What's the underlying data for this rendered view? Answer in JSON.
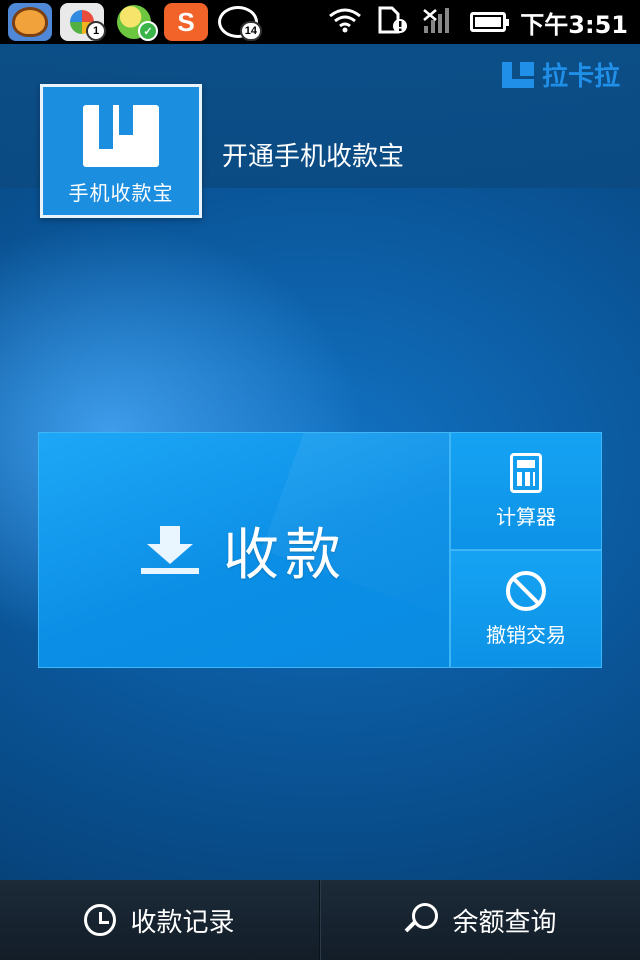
{
  "status_bar": {
    "notifications": [
      {
        "name": "monkey-app-icon"
      },
      {
        "name": "photo-app-icon",
        "badge": "1"
      },
      {
        "name": "qq-app-icon",
        "badge": "✓"
      },
      {
        "name": "sogou-app-icon"
      },
      {
        "name": "chat-app-icon",
        "badge": "14"
      }
    ],
    "icons": [
      "wifi-icon",
      "sim-alert-icon",
      "signal-icon",
      "battery-icon"
    ],
    "time": "下午3:51"
  },
  "header": {
    "brand": "拉卡拉",
    "app_tile_label": "手机收款宝",
    "open_text": "开通手机收款宝"
  },
  "actions": {
    "collect_label": "收款",
    "calculator_label": "计算器",
    "cancel_label": "撤销交易"
  },
  "bottom_nav": {
    "records_label": "收款记录",
    "balance_label": "余额查询"
  },
  "colors": {
    "accent": "#1c8ee0",
    "brand": "#1f8fe8",
    "button": "#0b8fe6",
    "background": "#0a5598"
  }
}
